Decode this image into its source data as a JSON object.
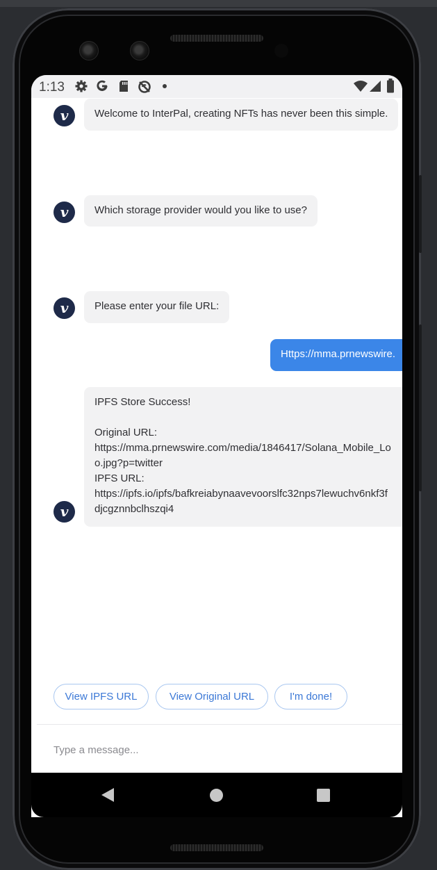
{
  "status_bar": {
    "time": "1:13",
    "left_icons": [
      "gear-icon",
      "google-g-icon",
      "sd-card-icon",
      "no-sync-icon",
      "dot-icon"
    ],
    "right_icons": [
      "wifi-icon",
      "signal-icon",
      "battery-icon"
    ]
  },
  "chat": {
    "bot_avatar_letter": "v",
    "messages": [
      {
        "sender": "bot",
        "text": "Welcome to InterPal, creating NFTs has never been this simple."
      },
      {
        "sender": "bot",
        "text": "Which storage provider would you like to use?"
      },
      {
        "sender": "bot",
        "text": "Please enter your file URL:"
      },
      {
        "sender": "user",
        "text": "Https://mma.prnewswire."
      },
      {
        "sender": "bot",
        "lines": [
          "IPFS Store Success!",
          "",
          "Original URL:",
          "https://mma.prnewswire.com/media/1846417/Solana_Mobile_Lo",
          "o.jpg?p=twitter",
          "IPFS URL:",
          "https://ipfs.io/ipfs/bafkreiabynaavevoorslfc32nps7lewuchv6nkf3f",
          "djcgznnbclhszqi4"
        ]
      }
    ]
  },
  "quick_replies": {
    "view_ipfs": "View IPFS URL",
    "view_original": "View Original URL",
    "done": "I'm done!"
  },
  "composer": {
    "placeholder": "Type a message..."
  },
  "colors": {
    "accent": "#3b86e8",
    "avatar_bg": "#1e2a49",
    "bubble_bg": "#f2f2f3"
  }
}
